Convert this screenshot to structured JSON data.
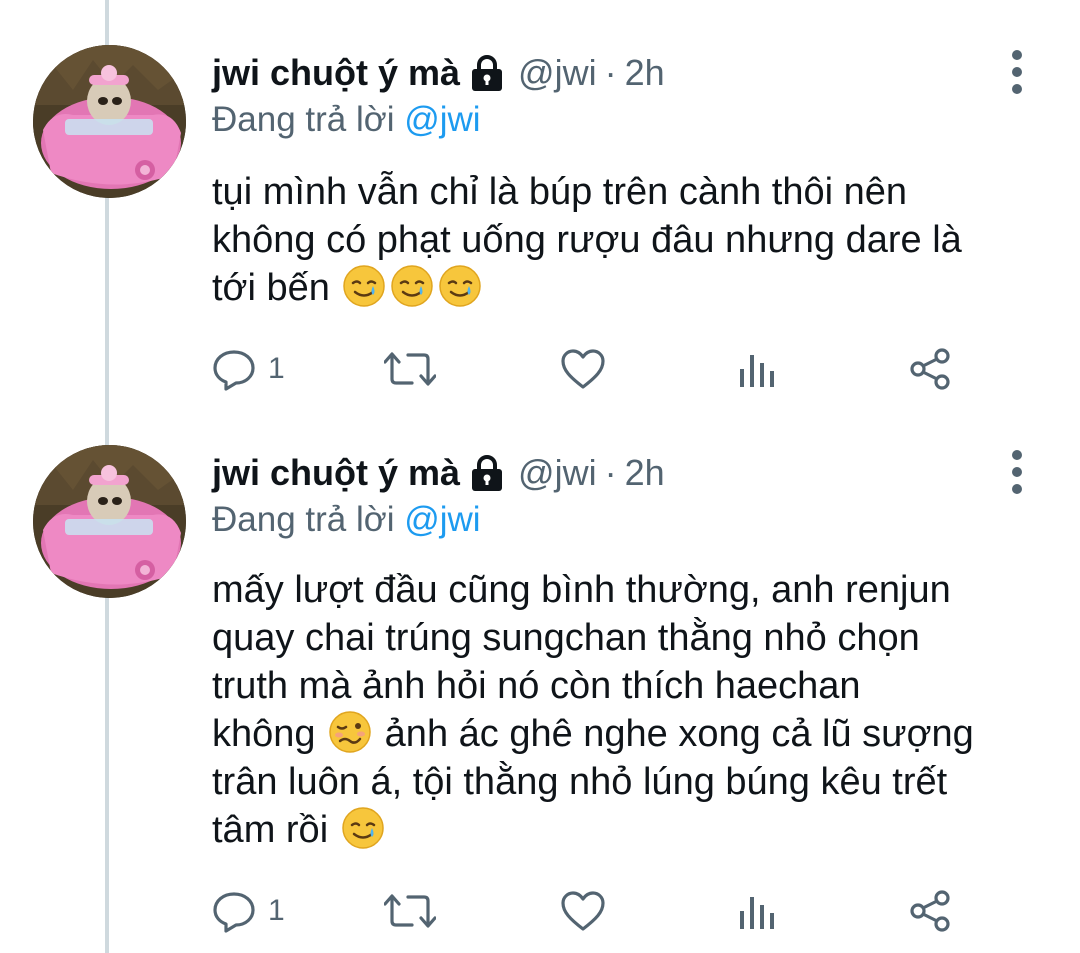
{
  "tweets": [
    {
      "author": {
        "display_name": "jwi chuột ý mà",
        "handle": "@jwi",
        "protected_icon": "lock-icon",
        "avatar": "avatar-hamster-pink-car"
      },
      "separator": "·",
      "time": "2h",
      "replying_prefix": "Đang trả lời",
      "replying_to": "@jwi",
      "text_lines": [
        "tụi mình vẫn chỉ là búp trên cành thôi nên",
        "không có phạt uống rượu đâu nhưng dare là",
        "tới bến"
      ],
      "emoji": [
        "smiling-face-with-tear",
        "smiling-face-with-tear",
        "smiling-face-with-tear"
      ],
      "actions": {
        "reply_count": "1",
        "retweet_count": "",
        "like_count": "",
        "icons": [
          "reply-icon",
          "retweet-icon",
          "like-icon",
          "views-icon",
          "share-icon"
        ]
      }
    },
    {
      "author": {
        "display_name": "jwi chuột ý mà",
        "handle": "@jwi",
        "protected_icon": "lock-icon",
        "avatar": "avatar-hamster-pink-car"
      },
      "separator": "·",
      "time": "2h",
      "replying_prefix": "Đang trả lời",
      "replying_to": "@jwi",
      "text_lines": [
        "mấy lượt đầu cũng bình thường, anh renjun",
        "quay chai trúng sungchan thằng nhỏ chọn",
        "truth mà ảnh hỏi nó còn thích haechan",
        "không",
        "ảnh ác ghê nghe xong cả lũ sượng",
        "trân luôn á, tội thằng nhỏ lúng búng kêu trết",
        "tâm rồi"
      ],
      "emoji": [
        "woozy-face",
        "smiling-face-with-tear"
      ],
      "actions": {
        "reply_count": "1",
        "retweet_count": "",
        "like_count": "",
        "icons": [
          "reply-icon",
          "retweet-icon",
          "like-icon",
          "views-icon",
          "share-icon"
        ]
      }
    }
  ],
  "colors": {
    "text": "#0f1419",
    "secondary": "#536471",
    "accent": "#1d9bf0",
    "thread_line": "#cfd9de"
  }
}
